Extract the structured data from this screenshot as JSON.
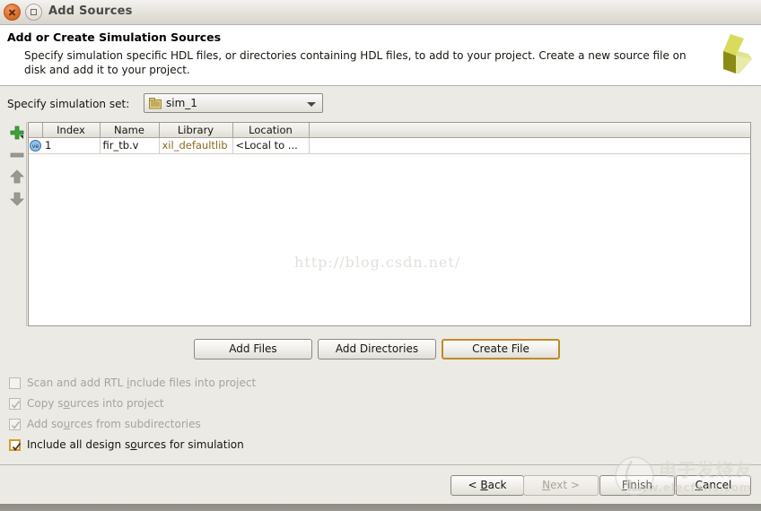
{
  "window": {
    "title": "Add Sources",
    "close_icon": "close-icon",
    "maximize_icon": "maximize-icon"
  },
  "header": {
    "title": "Add or Create Simulation Sources",
    "description": "Specify simulation specific HDL files, or directories containing HDL files, to add to your project. Create a new source file on disk and add it to your project.",
    "logo_icon": "xilinx-logo-icon",
    "logo_colors": {
      "dark": "#8a8a14",
      "mid": "#d8dc5a",
      "light": "#e8eaa8"
    }
  },
  "simulation_set": {
    "label": "Specify simulation set:",
    "value": "sim_1",
    "folder_icon": "folder-icon",
    "arrow_icon": "chevron-down-icon",
    "options": [
      "sim_1"
    ]
  },
  "toolbar": {
    "add": {
      "label": "Add Sources",
      "icon": "plus-icon",
      "color": "#3aa33a"
    },
    "remove": {
      "label": "Remove",
      "icon": "minus-icon",
      "color": "#9b9892"
    },
    "move_up": {
      "label": "Move Up",
      "icon": "arrow-up-icon",
      "color": "#9b9892"
    },
    "move_down": {
      "label": "Move Down",
      "icon": "arrow-down-icon",
      "color": "#9b9892"
    }
  },
  "table": {
    "columns": [
      "",
      "Index",
      "Name",
      "Library",
      "Location",
      ""
    ],
    "rows": [
      {
        "icon": "verilog-file-icon",
        "index": "1",
        "name": "fir_tb.v",
        "library": "xil_defaultlib",
        "location": "<Local to ..."
      }
    ],
    "library_color": "#8a6a1e"
  },
  "mid_buttons": {
    "add_files": "Add Files",
    "add_directories": "Add Directories",
    "create_file": "Create File",
    "focus_color": "#c08a28"
  },
  "options": [
    {
      "label_pre": "Scan and add RTL ",
      "label_u": "i",
      "label_post": "nclude files into project",
      "checked": false,
      "enabled": false
    },
    {
      "label_pre": "Copy s",
      "label_u": "o",
      "label_post": "urces into project",
      "checked": true,
      "enabled": false
    },
    {
      "label_pre": "Add so",
      "label_u": "u",
      "label_post": "rces from subdirectories",
      "checked": true,
      "enabled": false
    },
    {
      "label_pre": "Include all design s",
      "label_u": "o",
      "label_post": "urces for simulation",
      "checked": true,
      "enabled": true
    }
  ],
  "footer": {
    "back": "< Back",
    "back_u": "B",
    "next": "Next >",
    "next_u": "N",
    "next_disabled": true,
    "finish": "Finish",
    "finish_u": "F",
    "cancel": "Cancel",
    "cancel_u": "C"
  },
  "watermarks": {
    "csdn": "http://blog.csdn.net/",
    "elecfans_cn": "电子发烧友",
    "elecfans_url": "www.elecfans.com"
  }
}
